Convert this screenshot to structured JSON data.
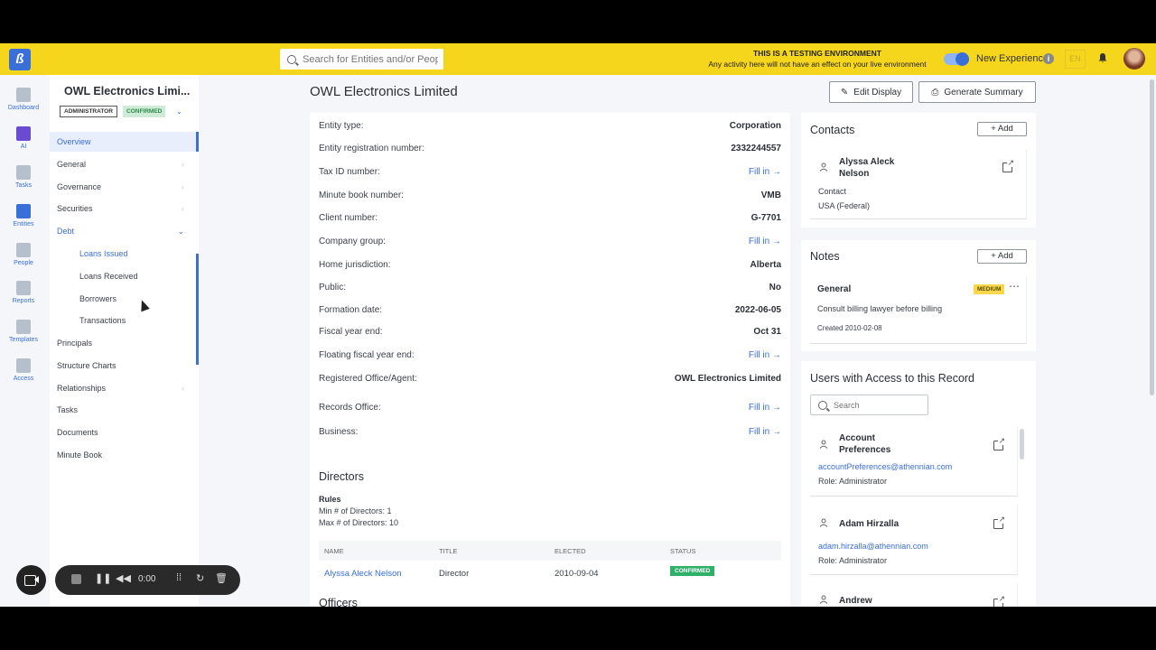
{
  "topbar": {
    "search_placeholder": "Search for Entities and/or People",
    "test_env_title": "THIS IS A TESTING ENVIRONMENT",
    "test_env_sub": "Any activity here will not have an effect on your live environment",
    "new_experience": "New Experience",
    "lang": "EN"
  },
  "rail": [
    "Dashboard",
    "AI",
    "Tasks",
    "Entities",
    "People",
    "Reports",
    "Templates",
    "Access"
  ],
  "nav": {
    "title": "OWL Electronics Limi...",
    "badge_admin": "ADMINISTRATOR",
    "badge_confirmed": "CONFIRMED",
    "items": [
      "Overview",
      "General",
      "Governance",
      "Securities",
      "Debt",
      "Loans Issued",
      "Loans Received",
      "Borrowers",
      "Transactions",
      "Principals",
      "Structure Charts",
      "Relationships",
      "Tasks",
      "Documents",
      "Minute Book"
    ]
  },
  "main": {
    "title": "OWL Electronics Limited",
    "edit_display": "Edit Display",
    "generate_summary": "Generate Summary",
    "fill_in": "Fill in",
    "fields": [
      {
        "k": "Entity type:",
        "v": "Corporation"
      },
      {
        "k": "Entity registration number:",
        "v": "2332244557"
      },
      {
        "k": "Tax ID number:",
        "v": ""
      },
      {
        "k": "Minute book number:",
        "v": "VMB"
      },
      {
        "k": "Client number:",
        "v": "G-7701"
      },
      {
        "k": "Company group:",
        "v": ""
      },
      {
        "k": "Home jurisdiction:",
        "v": "Alberta"
      },
      {
        "k": "Public:",
        "v": "No"
      },
      {
        "k": "Formation date:",
        "v": "2022-06-05"
      },
      {
        "k": "Fiscal year end:",
        "v": "Oct 31"
      },
      {
        "k": "Floating fiscal year end:",
        "v": ""
      },
      {
        "k": "Registered Office/Agent:",
        "v": "OWL Electronics Limited"
      },
      {
        "k": "Records Office:",
        "v": ""
      },
      {
        "k": "Business:",
        "v": ""
      }
    ],
    "directors": {
      "title": "Directors",
      "rules": "Rules",
      "min": "Min # of Directors: 1",
      "max": "Max # of Directors: 10",
      "headers": [
        "NAME",
        "TITLE",
        "ELECTED",
        "STATUS"
      ],
      "row": {
        "name": "Alyssa Aleck Nelson",
        "title": "Director",
        "elected": "2010-09-04",
        "status": "CONFIRMED"
      }
    },
    "officers_title": "Officers"
  },
  "contacts": {
    "title": "Contacts",
    "add": "Add",
    "name": "Alyssa Aleck Nelson",
    "role": "Contact",
    "jurisdiction": "USA (Federal)"
  },
  "notes": {
    "title": "Notes",
    "add": "Add",
    "category": "General",
    "priority": "MEDIUM",
    "text": "Consult billing lawyer before billing",
    "created": "Created 2010-02-08"
  },
  "access": {
    "title": "Users with Access to this Record",
    "search_placeholder": "Search",
    "users": [
      {
        "name": "Account Preferences",
        "email": "accountPreferences@athennian.com",
        "role": "Role: Administrator"
      },
      {
        "name": "Adam Hirzalla",
        "email": "adam.hirzalla@athennian.com",
        "role": "Role: Administrator"
      },
      {
        "name": "Andrew",
        "email": "",
        "role": ""
      }
    ]
  },
  "recorder": {
    "time": "0:00"
  },
  "colors": {
    "accent": "#3a6fd8",
    "topbar": "#f5d61c",
    "confirmed": "#2e8a47"
  }
}
